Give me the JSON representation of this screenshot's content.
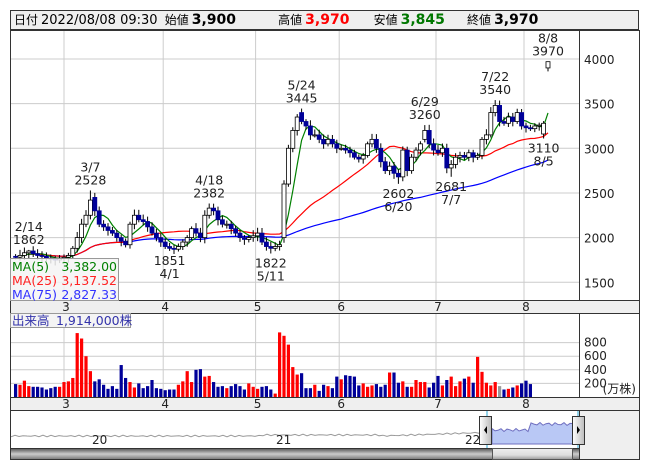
{
  "header": {
    "date_label": "日付",
    "date_value": "2022/08/08 09:30",
    "open_label": "始値",
    "open_value": "3,900",
    "high_label": "高値",
    "high_value": "3,970",
    "low_label": "安値",
    "low_value": "3,845",
    "close_label": "終値",
    "close_value": "3,970"
  },
  "colors": {
    "up": "#ff0000",
    "down": "#000099",
    "ma5": "#008000",
    "ma25": "#ff0000",
    "ma75": "#0000ff",
    "high_text": "#ff0000",
    "low_text": "#007700"
  },
  "legend": {
    "ma5": "MA(5)",
    "ma5_value": "3,382.00",
    "ma25": "MA(25)",
    "ma25_value": "3,137.52",
    "ma75": "MA(75)",
    "ma75_value": "2,827.33",
    "volume_label": "出来高",
    "volume_value": "1,914,000株"
  },
  "chart_data": {
    "type": "candlestick",
    "price_axis": {
      "ylim": [
        1300,
        4300
      ],
      "ticks": [
        "4000",
        "3500",
        "3000",
        "2500",
        "2000",
        "1500"
      ]
    },
    "month_ticks": [
      {
        "label": "3",
        "index": 11
      },
      {
        "label": "4",
        "index": 34
      },
      {
        "label": "5",
        "index": 55
      },
      {
        "label": "6",
        "index": 74
      },
      {
        "label": "7",
        "index": 96
      },
      {
        "label": "8",
        "index": 116
      }
    ],
    "close": [
      1780,
      1800,
      1830,
      1850,
      1820,
      1800,
      1790,
      1770,
      1760,
      1750,
      1770,
      1780,
      1800,
      1880,
      2000,
      2150,
      2250,
      2420,
      2300,
      2150,
      2120,
      2080,
      2050,
      2000,
      1960,
      1920,
      2150,
      2250,
      2200,
      2180,
      2120,
      2050,
      2000,
      1950,
      1900,
      1880,
      1870,
      1900,
      1950,
      2000,
      2100,
      2050,
      2000,
      2250,
      2330,
      2300,
      2200,
      2150,
      2150,
      2100,
      2050,
      2000,
      1980,
      2000,
      2020,
      2050,
      1950,
      1900,
      1880,
      1900,
      1920,
      2600,
      3000,
      3200,
      3350,
      3300,
      3250,
      3150,
      3150,
      3100,
      3050,
      3100,
      3050,
      3000,
      3000,
      2980,
      2950,
      2900,
      2880,
      2920,
      3050,
      3100,
      3000,
      2850,
      2750,
      2800,
      2720,
      2680,
      2980,
      2750,
      2900,
      2980,
      3050,
      3200,
      3050,
      2980,
      2950,
      3000,
      2780,
      2820,
      2900,
      2920,
      2900,
      2950,
      2900,
      2920,
      3100,
      3150,
      3400,
      3480,
      3300,
      3280,
      3350,
      3300,
      3400,
      3250,
      3230,
      3220,
      3250,
      3260,
      3280,
      3970
    ],
    "open": [
      1790,
      1780,
      1800,
      1830,
      1850,
      1820,
      1800,
      1790,
      1770,
      1760,
      1750,
      1770,
      1780,
      1800,
      1880,
      2000,
      2150,
      2250,
      2450,
      2300,
      2150,
      2120,
      2080,
      2050,
      2000,
      1960,
      1920,
      2150,
      2250,
      2200,
      2180,
      2120,
      2050,
      2000,
      1950,
      1900,
      1880,
      1870,
      1900,
      1950,
      2000,
      2100,
      2050,
      2000,
      2250,
      2330,
      2300,
      2200,
      2150,
      2150,
      2100,
      2050,
      2000,
      1980,
      2000,
      2020,
      2050,
      1950,
      1900,
      1880,
      1900,
      2000,
      2600,
      3000,
      3200,
      3400,
      3300,
      3250,
      3150,
      3150,
      3100,
      3050,
      3100,
      3050,
      3000,
      3000,
      2980,
      2950,
      2900,
      2880,
      2920,
      3050,
      3100,
      3000,
      2850,
      2750,
      2800,
      2720,
      2680,
      2980,
      2750,
      2900,
      2980,
      3100,
      3200,
      3050,
      2980,
      2950,
      3000,
      2780,
      2820,
      2900,
      2920,
      2900,
      2950,
      2900,
      2920,
      3100,
      3150,
      3400,
      3480,
      3300,
      3280,
      3350,
      3300,
      3400,
      3250,
      3230,
      3220,
      3250,
      3160,
      3900
    ],
    "annotations": [
      {
        "date": "2/14",
        "value": "1862",
        "index": 3,
        "kind": "high"
      },
      {
        "date": "3/7",
        "value": "2528",
        "index": 17,
        "kind": "high"
      },
      {
        "date": "4/1",
        "value": "1851",
        "index": 35,
        "kind": "low"
      },
      {
        "date": "4/18",
        "value": "2382",
        "index": 44,
        "kind": "high"
      },
      {
        "date": "5/11",
        "value": "1822",
        "index": 58,
        "kind": "low"
      },
      {
        "date": "5/24",
        "value": "3445",
        "index": 65,
        "kind": "high"
      },
      {
        "date": "6/20",
        "value": "2602",
        "index": 87,
        "kind": "low"
      },
      {
        "date": "6/29",
        "value": "3260",
        "index": 93,
        "kind": "high"
      },
      {
        "date": "7/7",
        "value": "2681",
        "index": 99,
        "kind": "low"
      },
      {
        "date": "7/22",
        "value": "3540",
        "index": 109,
        "kind": "high"
      },
      {
        "date": "8/5",
        "value": "3110",
        "index": 120,
        "kind": "low"
      },
      {
        "date": "8/8",
        "value": "3970",
        "index": 121,
        "kind": "high"
      }
    ],
    "volume": {
      "unit": "(万株)",
      "ticks": [
        "800",
        "600",
        "400",
        "200"
      ],
      "values": [
        190,
        180,
        240,
        160,
        150,
        150,
        140,
        110,
        130,
        150,
        150,
        220,
        230,
        280,
        940,
        860,
        600,
        380,
        230,
        260,
        180,
        120,
        160,
        120,
        470,
        280,
        220,
        140,
        200,
        130,
        160,
        250,
        130,
        120,
        100,
        110,
        110,
        180,
        230,
        380,
        220,
        400,
        410,
        300,
        310,
        220,
        150,
        160,
        130,
        160,
        190,
        160,
        110,
        200,
        150,
        120,
        150,
        160,
        110,
        50,
        950,
        900,
        770,
        440,
        330,
        350,
        130,
        130,
        180,
        90,
        180,
        160,
        130,
        300,
        260,
        320,
        310,
        300,
        170,
        200,
        150,
        170,
        190,
        150,
        180,
        360,
        360,
        210,
        230,
        150,
        150,
        250,
        220,
        220,
        140,
        210,
        310,
        170,
        250,
        300,
        160,
        230,
        270,
        300,
        210,
        590,
        370,
        210,
        170,
        220,
        160,
        110,
        120,
        140,
        170,
        200,
        240,
        190
      ]
    },
    "navigator": {
      "labels": [
        "20",
        "21",
        "22"
      ]
    }
  }
}
